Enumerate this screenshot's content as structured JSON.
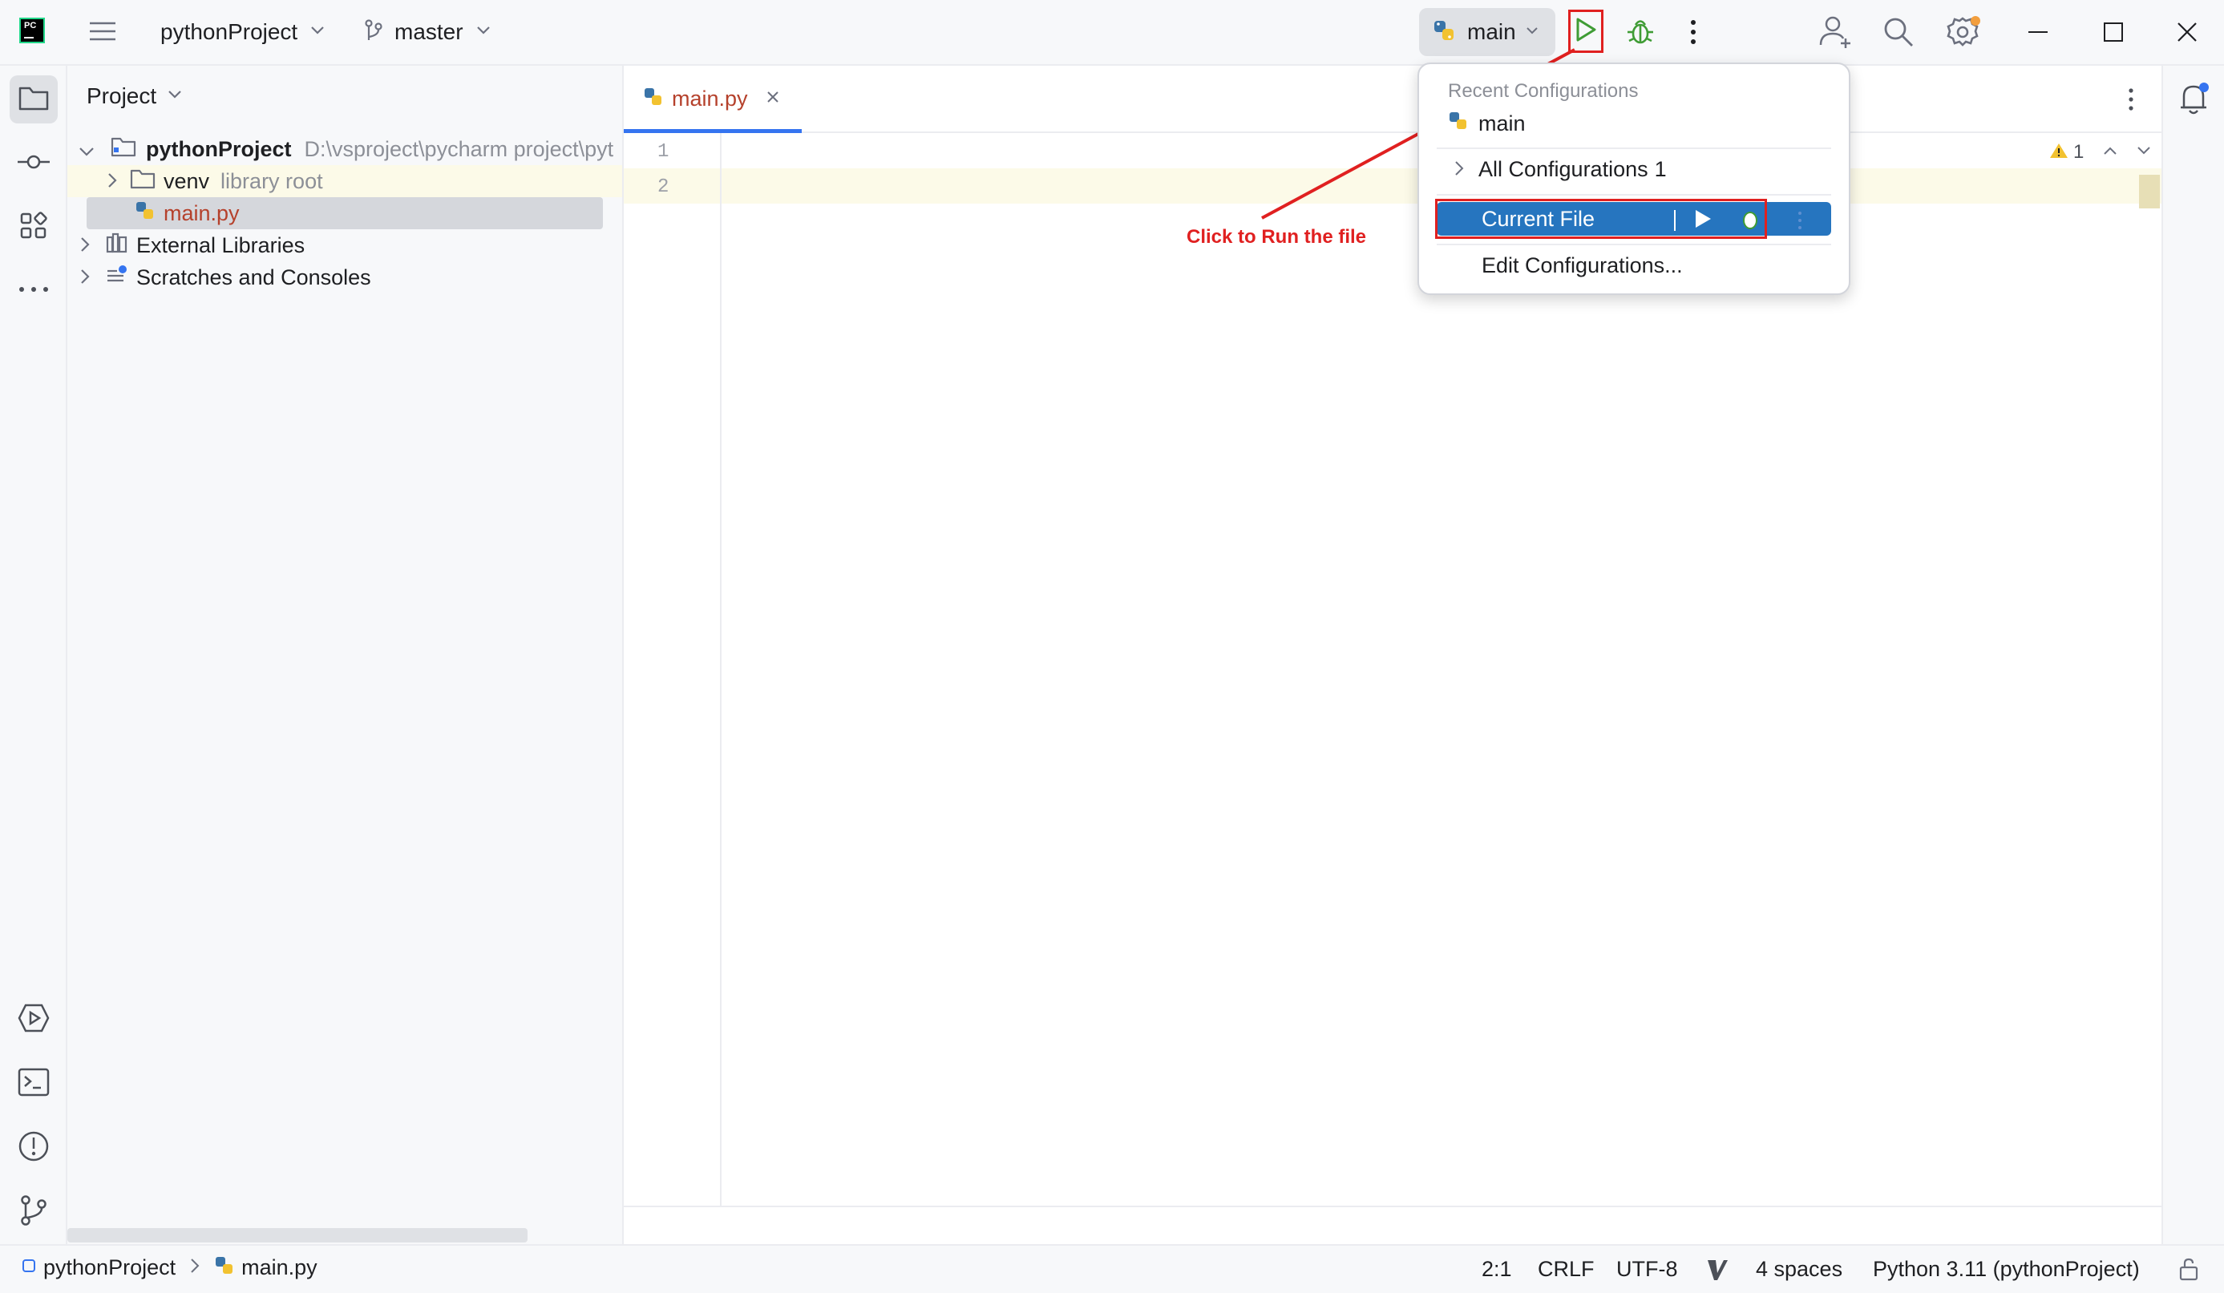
{
  "titlebar": {
    "project_name": "pythonProject",
    "branch": "master",
    "run_config": "main"
  },
  "project_panel": {
    "title": "Project",
    "tree": [
      {
        "label": "pythonProject",
        "hint": "D:\\vsproject\\pycharm project\\pyt"
      },
      {
        "label": "venv",
        "hint": "library root"
      },
      {
        "label": "main.py",
        "hint": ""
      },
      {
        "label": "External Libraries",
        "hint": ""
      },
      {
        "label": "Scratches and Consoles",
        "hint": ""
      }
    ]
  },
  "editor": {
    "tab_label": "main.py",
    "line_numbers": [
      "1",
      "2"
    ],
    "warning_count": "1"
  },
  "popup": {
    "section_header": "Recent Configurations",
    "recent_item": "main",
    "all_configs": "All Configurations",
    "all_configs_count": "1",
    "current_file": "Current File",
    "edit_configs": "Edit Configurations..."
  },
  "annotation": {
    "text": "Click to Run the file",
    "color": "#e02020"
  },
  "statusbar": {
    "breadcrumb_project": "pythonProject",
    "breadcrumb_file": "main.py",
    "position": "2:1",
    "line_sep": "CRLF",
    "encoding": "UTF-8",
    "indent": "4 spaces",
    "interpreter": "Python 3.11 (pythonProject)"
  },
  "colors": {
    "accent": "#2675bf",
    "run_green": "#3f9c35",
    "file_name_red": "#b5412c",
    "highlight_red": "#e02020"
  },
  "icons": [
    "pycharm-logo-icon",
    "hamburger-menu-icon",
    "branch-icon",
    "python-icon",
    "run-icon",
    "debug-icon",
    "more-vertical-icon",
    "add-user-icon",
    "search-icon",
    "settings-icon",
    "minimize-icon",
    "maximize-icon",
    "close-icon",
    "folder-icon",
    "commit-icon",
    "structure-icon",
    "more-horizontal-icon",
    "services-icon",
    "terminal-icon",
    "problems-icon",
    "git-icon",
    "notifications-icon",
    "library-icon",
    "scratches-icon",
    "warning-icon",
    "lock-icon"
  ]
}
